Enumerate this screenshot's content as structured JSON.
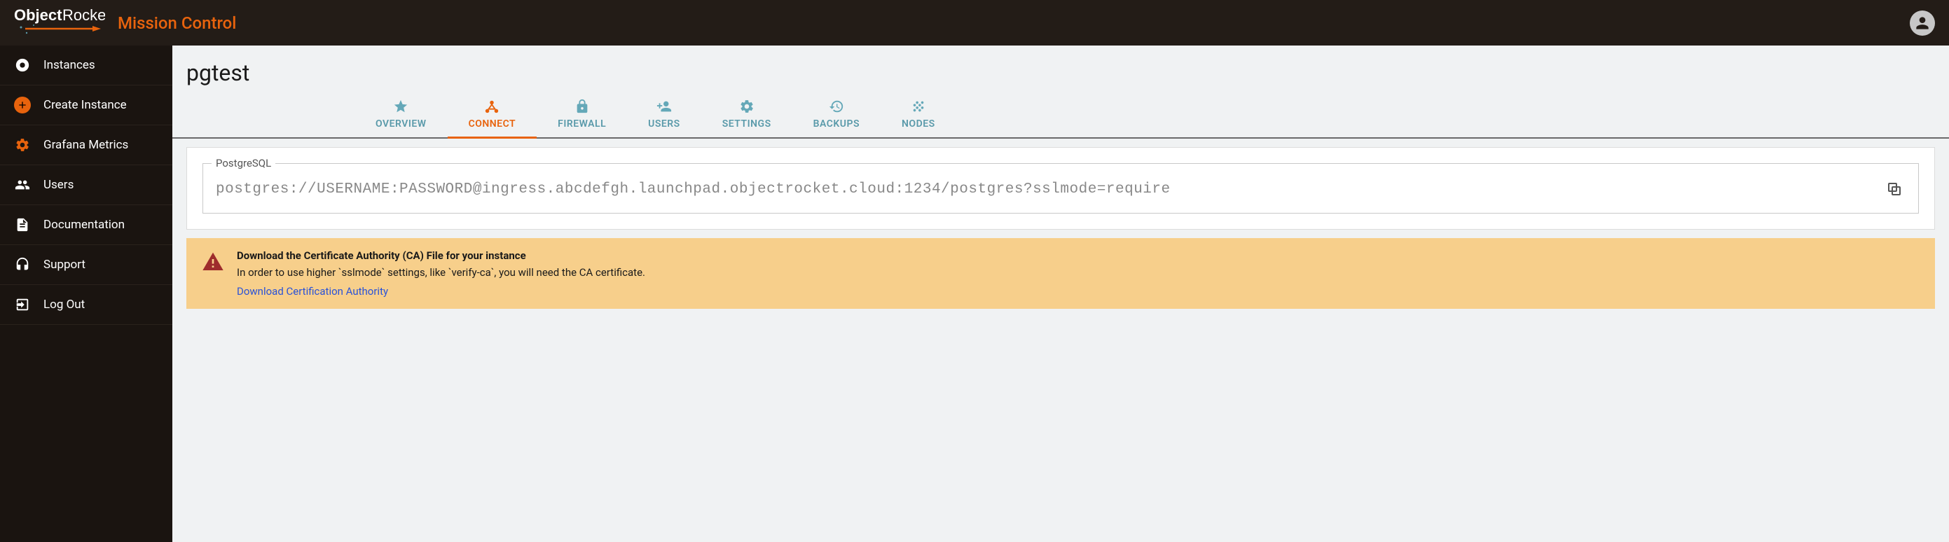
{
  "header": {
    "brand_object": "Object",
    "brand_rocket": "Rocket",
    "app_title": "Mission Control"
  },
  "sidebar": {
    "items": [
      {
        "label": "Instances"
      },
      {
        "label": "Create Instance"
      },
      {
        "label": "Grafana Metrics"
      },
      {
        "label": "Users"
      },
      {
        "label": "Documentation"
      },
      {
        "label": "Support"
      },
      {
        "label": "Log Out"
      }
    ]
  },
  "page": {
    "title": "pgtest"
  },
  "tabs": [
    {
      "label": "OVERVIEW"
    },
    {
      "label": "CONNECT"
    },
    {
      "label": "FIREWALL"
    },
    {
      "label": "USERS"
    },
    {
      "label": "SETTINGS"
    },
    {
      "label": "BACKUPS"
    },
    {
      "label": "NODES"
    }
  ],
  "connect": {
    "fieldset_label": "PostgreSQL",
    "connection_string": "postgres://USERNAME:PASSWORD@ingress.abcdefgh.launchpad.objectrocket.cloud:1234/postgres?sslmode=require"
  },
  "warning": {
    "title": "Download the Certificate Authority (CA) File for your instance",
    "text": "In order to use higher `sslmode` settings, like `verify-ca`, you will need the CA certificate.",
    "link_text": "Download Certification Authority"
  }
}
